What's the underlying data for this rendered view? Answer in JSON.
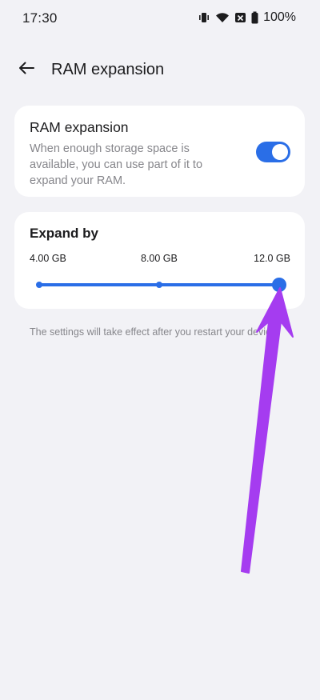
{
  "status_bar": {
    "time": "17:30",
    "battery": "100%"
  },
  "header": {
    "title": "RAM expansion",
    "back_icon": "arrow-left-icon"
  },
  "ram_expansion": {
    "title": "RAM expansion",
    "description": "When enough storage space is available, you can use part of it to expand your RAM.",
    "enabled": true
  },
  "expand_by": {
    "title": "Expand by",
    "options": [
      "4.00 GB",
      "8.00 GB",
      "12.0 GB"
    ],
    "selected": "12.0 GB",
    "selected_index": 2
  },
  "footnote": "The settings will take effect after you restart your device.",
  "colors": {
    "accent": "#2a6ee7",
    "background": "#f2f2f6",
    "annotation": "#a53cf0"
  }
}
